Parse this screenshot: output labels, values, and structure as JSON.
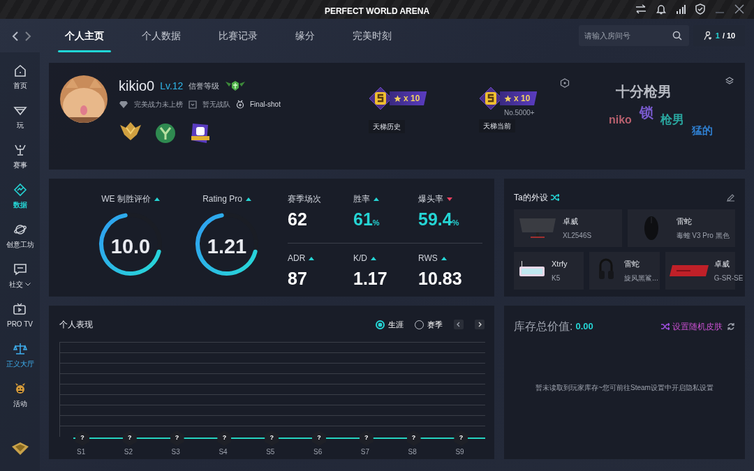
{
  "window": {
    "title": "PERFECT WORLD ARENA"
  },
  "tabs": [
    {
      "label": "个人主页",
      "selected": true
    },
    {
      "label": "个人数据",
      "selected": false
    },
    {
      "label": "比赛记录",
      "selected": false
    },
    {
      "label": "缘分",
      "selected": false
    },
    {
      "label": "完美时刻",
      "selected": false
    }
  ],
  "search": {
    "placeholder": "请输入房间号"
  },
  "room": {
    "current": "1",
    "total": "/ 10"
  },
  "sidebar": {
    "items": [
      {
        "label": "首页",
        "kind": "home",
        "selected": false
      },
      {
        "label": "玩",
        "kind": "play",
        "selected": false
      },
      {
        "label": "赛事",
        "kind": "trophy",
        "selected": false
      },
      {
        "label": "数据",
        "kind": "data",
        "selected": true
      },
      {
        "label": "创意工坊",
        "kind": "planet",
        "selected": false
      },
      {
        "label": "社交",
        "kind": "chat",
        "selected": false,
        "has_menu": true
      },
      {
        "label": "PRO TV",
        "kind": "tv",
        "selected": false
      },
      {
        "label": "正义大厅",
        "kind": "scale",
        "selected": false,
        "accent": true
      },
      {
        "label": "活动",
        "kind": "event",
        "selected": false
      }
    ]
  },
  "profile": {
    "name": "kikio0",
    "level": "Lv.12",
    "credit_label": "信誉等级",
    "power": "完美战力未上榜",
    "team": "暂无战队",
    "title": "Final-shot",
    "ladder": [
      {
        "count": "x 10",
        "caption": "天梯历史"
      },
      {
        "count": "x 10",
        "rank": "No.5000+",
        "caption": "天梯当前"
      }
    ],
    "tags": [
      {
        "text": "十分枪男",
        "color": "#b9bcc4"
      },
      {
        "text": "niko",
        "color": "#b8606e"
      },
      {
        "text": "锁",
        "color": "#7a5bd0"
      },
      {
        "text": "枪男",
        "color": "#2aa7a0"
      },
      {
        "text": "猛的",
        "color": "#2f7fd0"
      }
    ]
  },
  "ratings": [
    {
      "label": "WE 制胜评价",
      "value": "10.0",
      "level": 0.68,
      "rising": true
    },
    {
      "label": "Rating Pro",
      "value": "1.21",
      "level": 0.68,
      "rising": true
    }
  ],
  "stats": [
    {
      "label": "赛季场次",
      "value": "62",
      "highlight": false
    },
    {
      "label": "胜率",
      "value": "61",
      "unit": "%",
      "rising": true,
      "highlight": true
    },
    {
      "label": "爆头率",
      "value": "59.4",
      "unit": "%",
      "rising": false,
      "highlight": true
    },
    {
      "label": "ADR",
      "value": "87",
      "rising": true,
      "highlight": false
    },
    {
      "label": "K/D",
      "value": "1.17",
      "rising": true,
      "highlight": false
    },
    {
      "label": "RWS",
      "value": "10.83",
      "rising": true,
      "highlight": false
    }
  ],
  "peripherals": {
    "title": "Ta的外设",
    "items": [
      {
        "kind": "monitor",
        "brand": "卓威",
        "model": "XL2546S"
      },
      {
        "kind": "mouse",
        "brand": "雷蛇",
        "model": "毒蝰 V3 Pro 黑色"
      },
      {
        "kind": "keyboard",
        "brand": "Xtrfy",
        "model": "K5"
      },
      {
        "kind": "headset",
        "brand": "雷蛇",
        "model": "旋风黑鲨..."
      },
      {
        "kind": "mousepad",
        "brand": "卓威",
        "model": "G-SR-SE"
      }
    ]
  },
  "performance": {
    "title": "个人表现",
    "modes": [
      {
        "label": "生涯",
        "selected": true
      },
      {
        "label": "赛季",
        "selected": false
      }
    ],
    "seasons": [
      {
        "label": "S1",
        "marker": "?"
      },
      {
        "label": "S2",
        "marker": "?"
      },
      {
        "label": "S3",
        "marker": "?"
      },
      {
        "label": "S4",
        "marker": "?"
      },
      {
        "label": "S5",
        "marker": "?"
      },
      {
        "label": "S6",
        "marker": "?"
      },
      {
        "label": "S7",
        "marker": "?"
      },
      {
        "label": "S8",
        "marker": "?"
      },
      {
        "label": "S9",
        "marker": "?"
      }
    ]
  },
  "inventory": {
    "label": "库存总价值:",
    "value": "0.00",
    "action": "设置随机皮肤",
    "message": "暂未读取到玩家库存~您可前往Steam设置中开启隐私设置"
  }
}
